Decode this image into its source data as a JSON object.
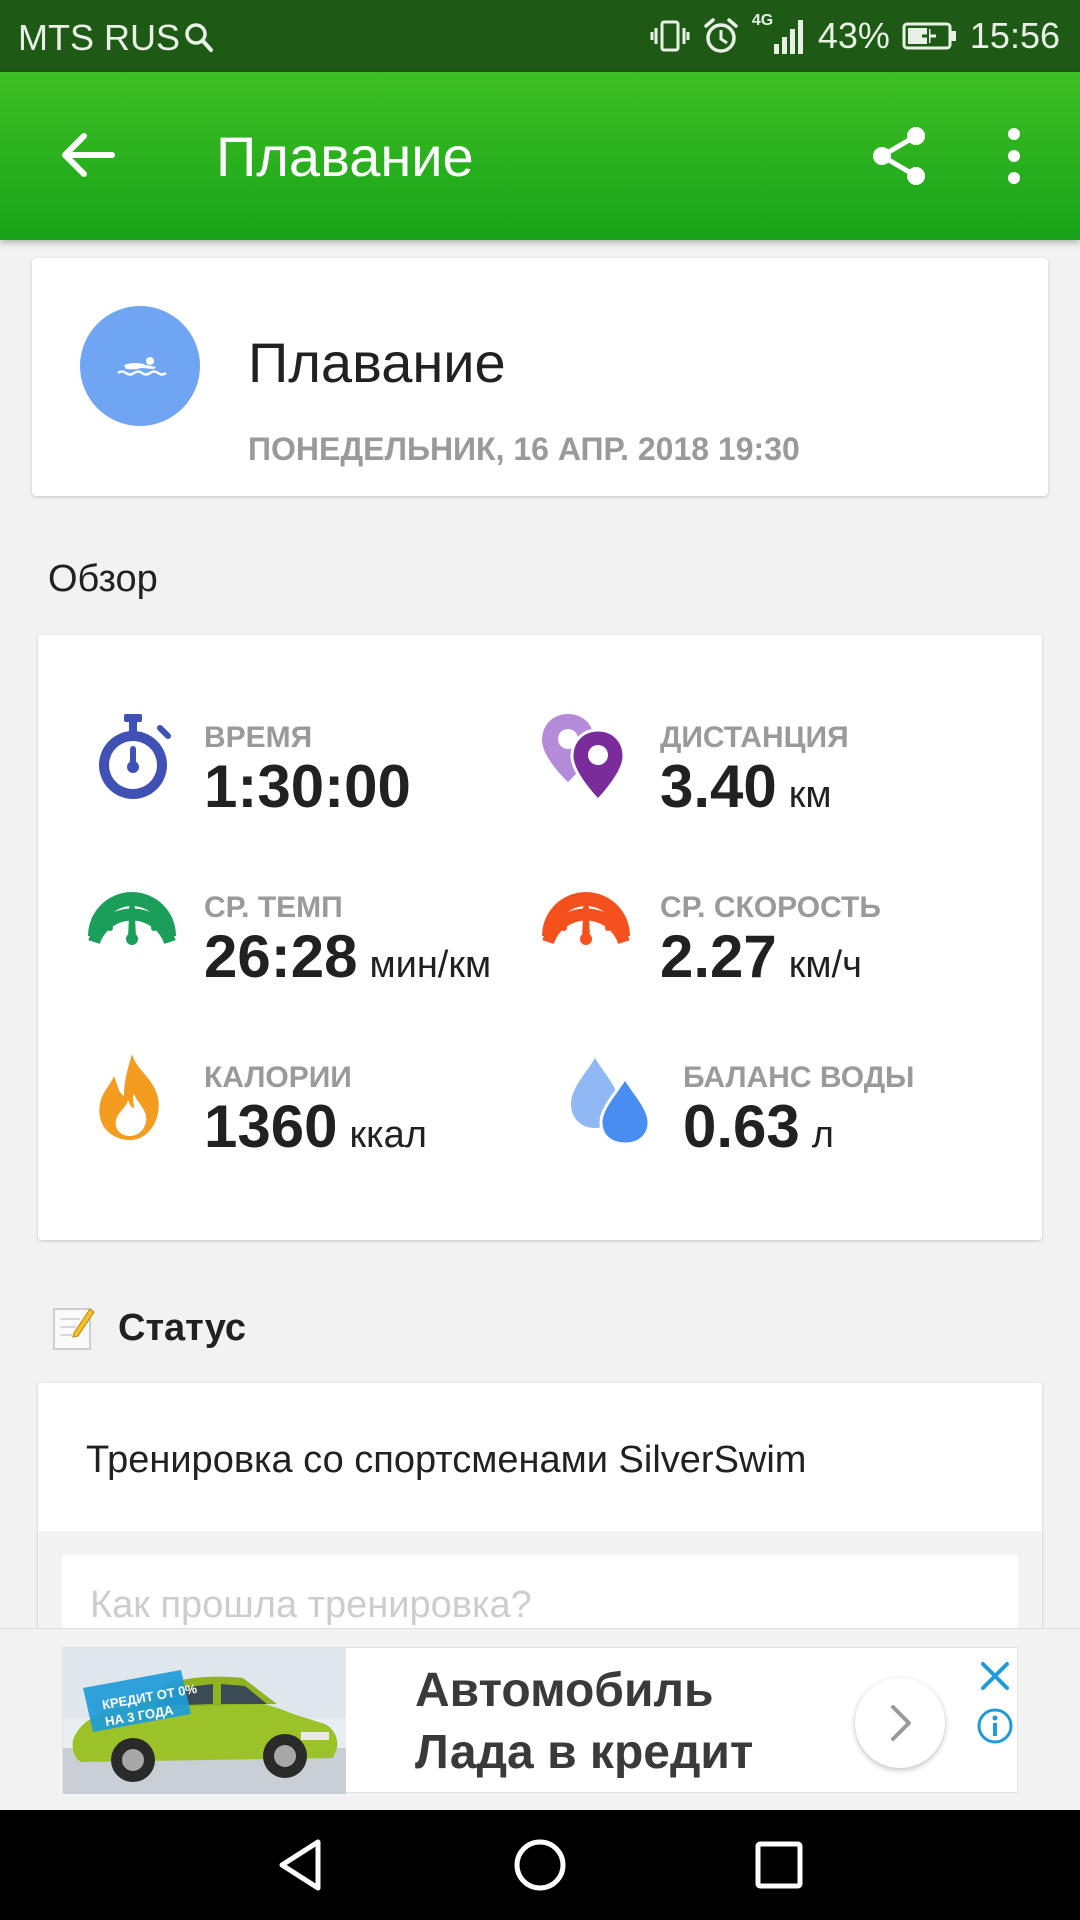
{
  "status_bar": {
    "carrier": "MTS RUS",
    "network": "4G",
    "battery": "43%",
    "time": "15:56"
  },
  "app_bar": {
    "title": "Плавание",
    "icons": [
      "back-arrow-icon",
      "share-icon",
      "more-vert-icon"
    ]
  },
  "activity": {
    "name": "Плавание",
    "datetime": "ПОНЕДЕЛЬНИК, 16 АПР. 2018 19:30",
    "icon": "swimmer-icon",
    "avatar_color": "#6fa5f2"
  },
  "overview": {
    "title": "Обзор",
    "stats": [
      {
        "key": "time",
        "label": "ВРЕМЯ",
        "value": "1:30:00",
        "unit": "",
        "icon": "stopwatch-icon",
        "color": "#3f51b5"
      },
      {
        "key": "distance",
        "label": "ДИСТАНЦИЯ",
        "value": "3.40",
        "unit": "км",
        "icon": "map-pins-icon",
        "color": "#8e44ad"
      },
      {
        "key": "pace",
        "label": "СР. ТЕМП",
        "value": "26:28",
        "unit": "мин/км",
        "icon": "speedometer-icon",
        "color": "#1a9e5a"
      },
      {
        "key": "speed",
        "label": "СР. СКОРОСТЬ",
        "value": "2.27",
        "unit": "км/ч",
        "icon": "speedometer-icon",
        "color": "#f4511e"
      },
      {
        "key": "calories",
        "label": "КАЛОРИИ",
        "value": "1360",
        "unit": "ккал",
        "icon": "flame-icon",
        "color": "#f39c1f"
      },
      {
        "key": "water",
        "label": "БАЛАНС ВОДЫ",
        "value": "0.63",
        "unit": "л",
        "icon": "water-drops-icon",
        "color": "#4a8df0"
      }
    ]
  },
  "status": {
    "title": "Статус",
    "text": "Тренировка со спортсменами SilverSwim",
    "comment_placeholder": "Как прошла тренировка?"
  },
  "ad": {
    "line1": "Автомобиль",
    "line2": "Лада в кредит",
    "badge_line1": "КРЕДИТ ОТ 0%",
    "badge_line2": "НА 3 ГОДА"
  },
  "colors": {
    "app_bar_top": "#3fbf24",
    "app_bar_bottom": "#17a318",
    "status_bar": "#1e5a16",
    "ad_accent": "#1e9bd8"
  }
}
